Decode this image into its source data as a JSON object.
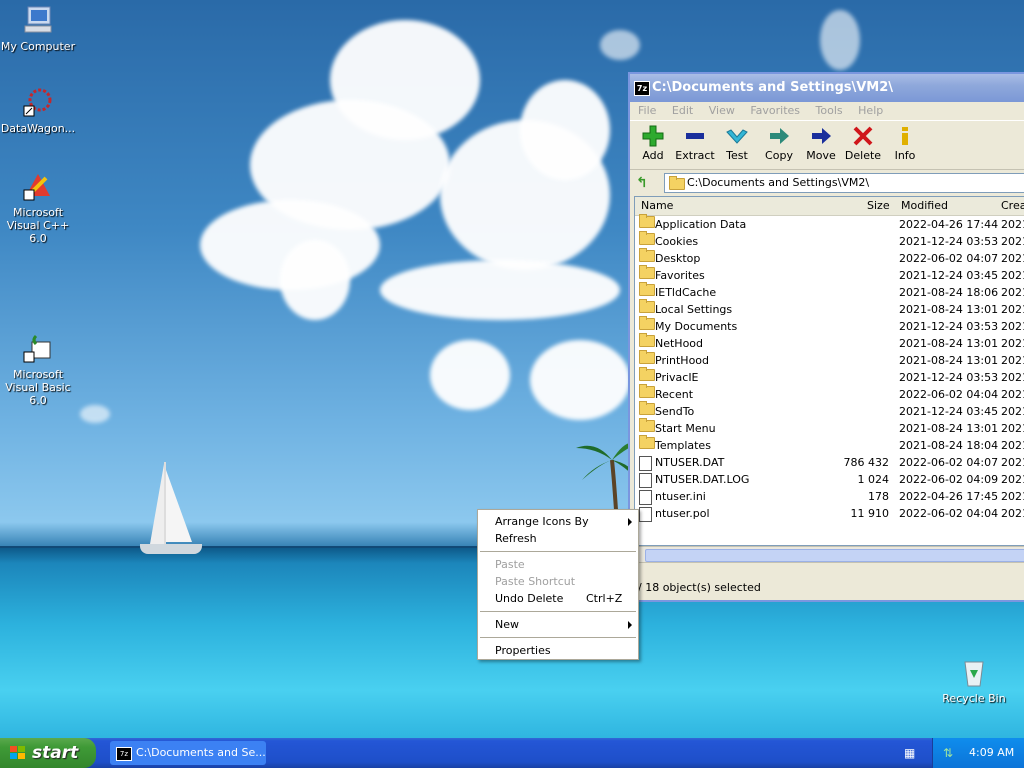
{
  "desktop": {
    "icons": [
      {
        "label": "My Computer"
      },
      {
        "label": "DataWagon..."
      },
      {
        "label": "Microsoft Visual C++ 6.0"
      },
      {
        "label": "Microsoft Visual Basic 6.0"
      },
      {
        "label": "Recycle Bin"
      }
    ]
  },
  "window": {
    "title": "C:\\Documents and Settings\\VM2\\",
    "app_icon": "7z",
    "menu": [
      "File",
      "Edit",
      "View",
      "Favorites",
      "Tools",
      "Help"
    ],
    "toolbar": [
      {
        "label": "Add",
        "icon": "plus-icon",
        "color": "#2eaa2e"
      },
      {
        "label": "Extract",
        "icon": "minus-icon",
        "color": "#1a2f9c"
      },
      {
        "label": "Test",
        "icon": "check-icon",
        "color": "#33b6d6"
      },
      {
        "label": "Copy",
        "icon": "copy-arrow-icon",
        "color": "#2c8a7a"
      },
      {
        "label": "Move",
        "icon": "move-arrow-icon",
        "color": "#1a2f9c"
      },
      {
        "label": "Delete",
        "icon": "x-icon",
        "color": "#d0161b"
      },
      {
        "label": "Info",
        "icon": "info-icon",
        "color": "#e0b000"
      }
    ],
    "address": "C:\\Documents and Settings\\VM2\\",
    "columns": [
      "Name",
      "Size",
      "Modified",
      "Crea"
    ],
    "rows": [
      {
        "name": "Application Data",
        "size": "",
        "modified": "2022-04-26 17:44",
        "created": "2021-",
        "type": "folder"
      },
      {
        "name": "Cookies",
        "size": "",
        "modified": "2021-12-24 03:53",
        "created": "2021-",
        "type": "folder"
      },
      {
        "name": "Desktop",
        "size": "",
        "modified": "2022-06-02 04:07",
        "created": "2021-",
        "type": "folder"
      },
      {
        "name": "Favorites",
        "size": "",
        "modified": "2021-12-24 03:45",
        "created": "2021-",
        "type": "folder"
      },
      {
        "name": "IETldCache",
        "size": "",
        "modified": "2021-08-24 18:06",
        "created": "2021-",
        "type": "folder"
      },
      {
        "name": "Local Settings",
        "size": "",
        "modified": "2021-08-24 13:01",
        "created": "2021-",
        "type": "folder"
      },
      {
        "name": "My Documents",
        "size": "",
        "modified": "2021-12-24 03:53",
        "created": "2021-",
        "type": "folder"
      },
      {
        "name": "NetHood",
        "size": "",
        "modified": "2021-08-24 13:01",
        "created": "2021-",
        "type": "folder"
      },
      {
        "name": "PrintHood",
        "size": "",
        "modified": "2021-08-24 13:01",
        "created": "2021-",
        "type": "folder"
      },
      {
        "name": "PrivacIE",
        "size": "",
        "modified": "2021-12-24 03:53",
        "created": "2021-",
        "type": "folder"
      },
      {
        "name": "Recent",
        "size": "",
        "modified": "2022-06-02 04:04",
        "created": "2021-",
        "type": "folder"
      },
      {
        "name": "SendTo",
        "size": "",
        "modified": "2021-12-24 03:45",
        "created": "2021-",
        "type": "folder"
      },
      {
        "name": "Start Menu",
        "size": "",
        "modified": "2021-08-24 13:01",
        "created": "2021-",
        "type": "folder"
      },
      {
        "name": "Templates",
        "size": "",
        "modified": "2021-08-24 18:04",
        "created": "2021-",
        "type": "folder"
      },
      {
        "name": "NTUSER.DAT",
        "size": "786 432",
        "modified": "2022-06-02 04:07",
        "created": "2021-",
        "type": "file"
      },
      {
        "name": "NTUSER.DAT.LOG",
        "size": "1 024",
        "modified": "2022-06-02 04:09",
        "created": "2021-",
        "type": "file"
      },
      {
        "name": "ntuser.ini",
        "size": "178",
        "modified": "2022-04-26 17:45",
        "created": "2021-",
        "type": "file"
      },
      {
        "name": "ntuser.pol",
        "size": "11 910",
        "modified": "2022-06-02 04:04",
        "created": "2021-",
        "type": "file"
      }
    ],
    "status": "/ 18 object(s) selected"
  },
  "context_menu": {
    "items": [
      {
        "label": "Arrange Icons By",
        "submenu": true,
        "disabled": false
      },
      {
        "label": "Refresh",
        "disabled": false
      },
      {
        "label": "Paste",
        "disabled": true
      },
      {
        "label": "Paste Shortcut",
        "disabled": true
      },
      {
        "label": "Undo Delete",
        "shortcut": "Ctrl+Z",
        "disabled": false
      },
      {
        "label": "New",
        "submenu": true,
        "disabled": false
      },
      {
        "label": "Properties",
        "disabled": false
      }
    ]
  },
  "taskbar": {
    "start_label": "start",
    "task_label": "C:\\Documents and Se...",
    "task_icon": "7z",
    "clock": "4:09 AM"
  }
}
